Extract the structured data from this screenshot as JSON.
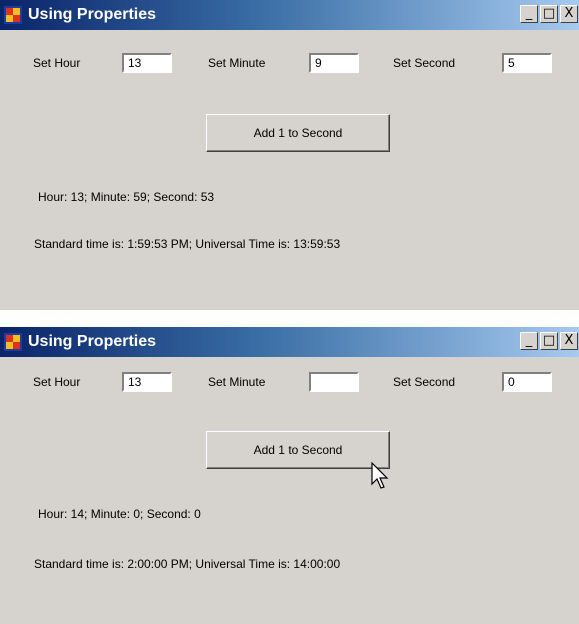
{
  "windows": [
    {
      "title": "Using Properties",
      "controls": {
        "minimize": "_",
        "maximize": "□",
        "close": "X"
      },
      "hour_label": "Set Hour",
      "hour_value": "13",
      "minute_label": "Set Minute",
      "minute_value": "9",
      "second_label": "Set Second",
      "second_value": "5",
      "button_label": "Add 1 to Second",
      "time_line": "Hour: 13; Minute: 59; Second: 53",
      "standard_line": "Standard time is: 1:59:53 PM; Universal Time is: 13:59:53"
    },
    {
      "title": "Using Properties",
      "controls": {
        "minimize": "_",
        "maximize": "□",
        "close": "X"
      },
      "hour_label": "Set Hour",
      "hour_value": "13",
      "minute_label": "Set Minute",
      "minute_value": "",
      "second_label": "Set Second",
      "second_value": "0",
      "button_label": "Add 1 to Second",
      "time_line": "Hour: 14; Minute: 0; Second: 0",
      "standard_line": "Standard time is: 2:00:00 PM; Universal Time is: 14:00:00"
    }
  ],
  "icons": [
    "app-icon",
    "mouse-pointer-icon"
  ]
}
